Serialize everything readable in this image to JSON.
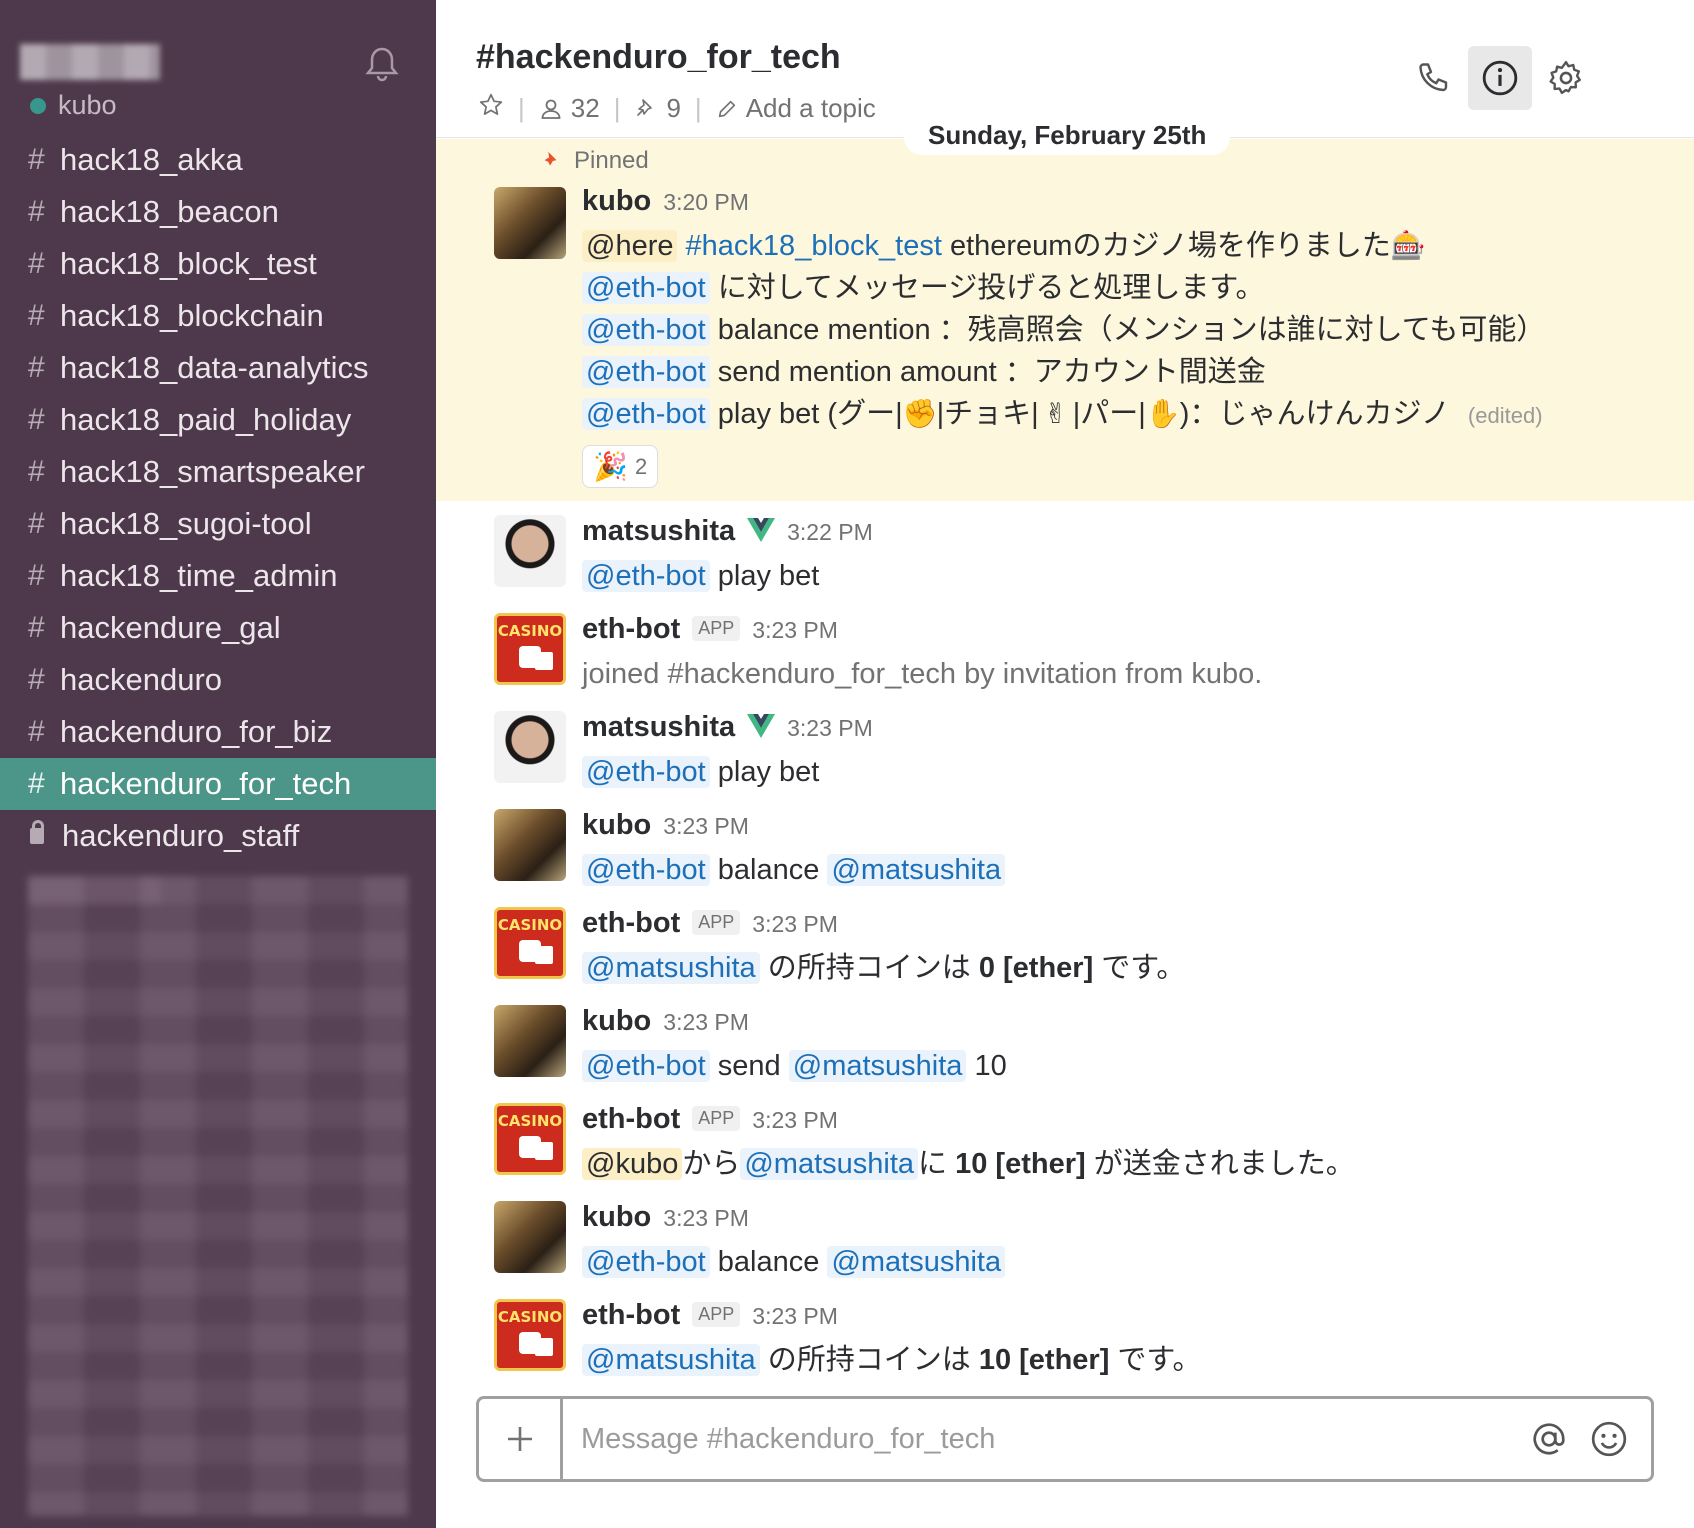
{
  "sidebar": {
    "current_user": "kubo",
    "presence_color": "#38978d",
    "channels": [
      {
        "prefix": "#",
        "name": "hack18_akka"
      },
      {
        "prefix": "#",
        "name": "hack18_beacon"
      },
      {
        "prefix": "#",
        "name": "hack18_block_test"
      },
      {
        "prefix": "#",
        "name": "hack18_blockchain"
      },
      {
        "prefix": "#",
        "name": "hack18_data-analytics"
      },
      {
        "prefix": "#",
        "name": "hack18_paid_holiday"
      },
      {
        "prefix": "#",
        "name": "hack18_smartspeaker"
      },
      {
        "prefix": "#",
        "name": "hack18_sugoi-tool"
      },
      {
        "prefix": "#",
        "name": "hack18_time_admin"
      },
      {
        "prefix": "#",
        "name": "hackendure_gal"
      },
      {
        "prefix": "#",
        "name": "hackenduro"
      },
      {
        "prefix": "#",
        "name": "hackenduro_for_biz"
      },
      {
        "prefix": "#",
        "name": "hackenduro_for_tech"
      },
      {
        "prefix": "lock",
        "name": "hackenduro_staff"
      }
    ],
    "active_channel": "hackenduro_for_tech",
    "sidebar_color": "#4d394b",
    "active_color": "#4c9689"
  },
  "header": {
    "channel_title": "#hackenduro_for_tech",
    "member_count": "32",
    "pinned_count": "9",
    "add_topic": "Add a topic",
    "icons": [
      "phone-icon",
      "info-icon",
      "gear-icon"
    ]
  },
  "date_divider": "Sunday, February 25th",
  "pinned_label": "Pinned",
  "pinned_message": {
    "author": "kubo",
    "time": "3:20 PM",
    "line1": {
      "mention": "@here",
      "channel": "#hack18_block_test",
      "text": "ethereumのカジノ場を作りました",
      "emoji": "🎰"
    },
    "line2": {
      "mention": "@eth-bot",
      "text": "に対してメッセージ投げると処理します。"
    },
    "line3": {
      "mention": "@eth-bot",
      "text": "balance mention ：残高照会（メンションは誰に対しても可能）"
    },
    "line4": {
      "mention": "@eth-bot",
      "text": "send mention amount ：アカウント間送金"
    },
    "line5": {
      "mention": "@eth-bot",
      "text_a": "play bet (グー|",
      "emoji_a": "✊",
      "text_b": "|チョキ|",
      "emoji_b": "✌",
      "text_c": "|パー|",
      "emoji_c": "✋",
      "text_d": ")：じゃんけんカジノ",
      "edited": "(edited)"
    },
    "reaction": {
      "emoji": "🎉",
      "count": "2"
    }
  },
  "messages": [
    {
      "author": "matsushita",
      "time": "3:22 PM",
      "mention": "@eth-bot",
      "text": "play bet"
    },
    {
      "author": "eth-bot",
      "badge": "APP",
      "time": "3:23 PM",
      "text": "joined #hackenduro_for_tech by invitation from kubo."
    },
    {
      "author": "matsushita",
      "time": "3:23 PM",
      "mention": "@eth-bot",
      "text": "play bet"
    },
    {
      "author": "kubo",
      "time": "3:23 PM",
      "mention": "@eth-bot",
      "text": "balance",
      "mention2": "@matsushita"
    },
    {
      "author": "eth-bot",
      "badge": "APP",
      "time": "3:23 PM",
      "mention": "@matsushita",
      "text_a": "の所持コインは",
      "bold": "0 [ether]",
      "text_b": "です。"
    },
    {
      "author": "kubo",
      "time": "3:23 PM",
      "mention": "@eth-bot",
      "text": "send",
      "mention2": "@matsushita",
      "text2": "10"
    },
    {
      "author": "eth-bot",
      "badge": "APP",
      "time": "3:23 PM",
      "mention": "@kubo",
      "text_a": "から",
      "mention2": "@matsushita",
      "text_b": "に",
      "bold": "10 [ether]",
      "text_c": "が送金されました。"
    },
    {
      "author": "kubo",
      "time": "3:23 PM",
      "mention": "@eth-bot",
      "text": "balance",
      "mention2": "@matsushita"
    },
    {
      "author": "eth-bot",
      "badge": "APP",
      "time": "3:23 PM",
      "mention": "@matsushita",
      "text_a": "の所持コインは",
      "bold": "10 [ether]",
      "text_b": "です。"
    }
  ],
  "avatar_texts": {
    "casino": "CASINO"
  },
  "composer": {
    "placeholder": "Message #hackenduro_for_tech"
  }
}
